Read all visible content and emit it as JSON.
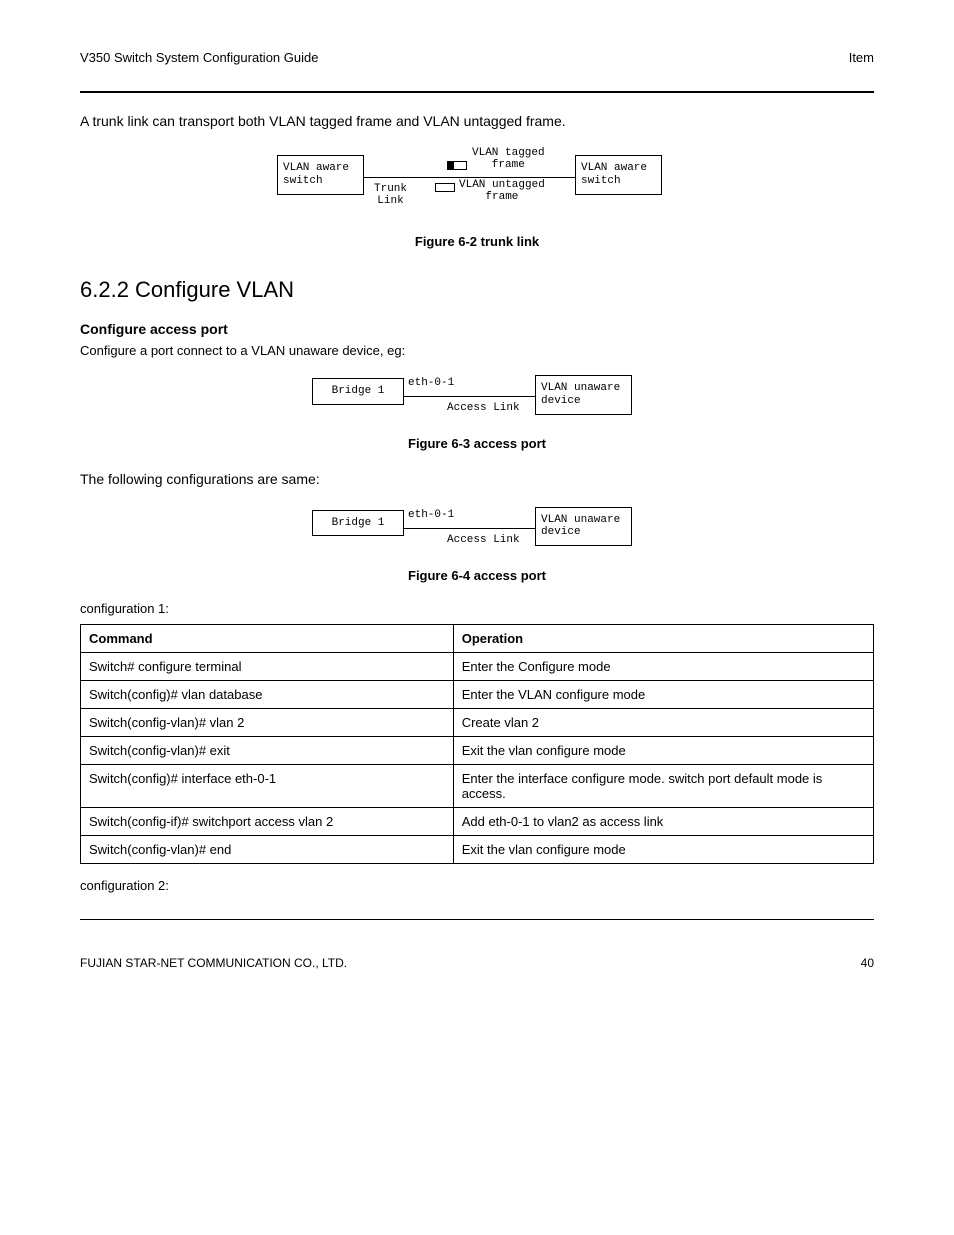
{
  "header": {
    "doc_title": "V350 Switch System Configuration Guide",
    "item": "Item"
  },
  "body": {
    "intro_para": "A trunk link can transport both VLAN tagged frame and VLAN untagged frame.",
    "fig1_caption": "Figure 6-2 trunk link",
    "subheading1": "6.2.2 Configure VLAN",
    "subheading1_sub": "Configure access port",
    "cfg_desc1": "Configure a port connect to a VLAN unaware device, eg:",
    "fig2_caption": "Figure 6-3 access port",
    "table_intro": "The following configurations are same:",
    "fig3_caption": "Figure 6-4 access port",
    "cfg1_title": "configuration 1:",
    "table": {
      "head_cmd": "Command",
      "head_op": "Operation",
      "rows": [
        {
          "cmd": "Switch# configure terminal",
          "op": "Enter the Configure mode"
        },
        {
          "cmd": "Switch(config)# vlan database",
          "op": "Enter the VLAN configure mode"
        },
        {
          "cmd": "Switch(config-vlan)# vlan 2",
          "op": "Create vlan 2"
        },
        {
          "cmd": "Switch(config-vlan)# exit",
          "op": "Exit the vlan configure mode"
        },
        {
          "cmd": "Switch(config)# interface eth-0-1",
          "op": "Enter the interface configure mode. switch port default mode is access."
        },
        {
          "cmd": "Switch(config-if)# switchport access vlan 2",
          "op": "Add eth-0-1 to vlan2 as access link"
        },
        {
          "cmd": "Switch(config-vlan)# end",
          "op": "Exit the vlan configure mode"
        }
      ]
    },
    "cfg2_title": "configuration 2:"
  },
  "diagram": {
    "vlan_aware_switch": "VLAN aware\nswitch",
    "trunk_link": "Trunk\nLink",
    "tagged": "VLAN tagged\nframe",
    "untagged": "VLAN untagged\nframe",
    "bridge1": "Bridge 1",
    "eth01": "eth-0-1",
    "access_link": "Access Link",
    "vlan_unaware_device": "VLAN unaware\ndevice"
  },
  "footer": {
    "company": "FUJIAN STAR-NET COMMUNICATION CO., LTD.",
    "page": "40"
  }
}
